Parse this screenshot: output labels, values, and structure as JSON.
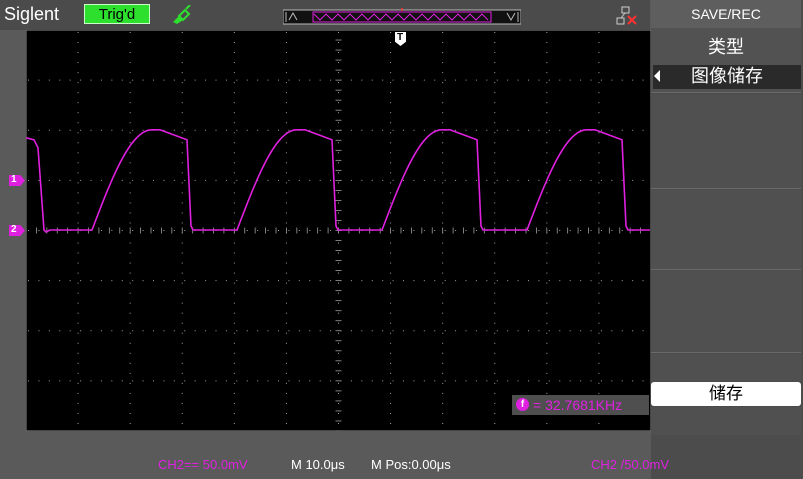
{
  "brand": "Siglent",
  "trigger_status": "Trig'd",
  "menu": {
    "title": "SAVE/REC",
    "type_label": "类型",
    "type_value": "图像储存",
    "save_label": "储存"
  },
  "measurement": {
    "icon": "f",
    "frequency": "= 32.7681KHz"
  },
  "status_bar": {
    "ch2_scale": "CH2== 50.0mV",
    "timebase": "M 10.0μs",
    "mpos": "M Pos:0.00μs",
    "trigger": "CH2 /50.0mV"
  },
  "markers": {
    "trigger_marker": "T",
    "ch_marker_1": "1",
    "ch_marker_2": "2"
  },
  "colors": {
    "trace": "#e020e0",
    "trig_ok": "#2ee02e",
    "grid": "#a0a0a0"
  },
  "waveform": {
    "period_us": 28.6,
    "high_level_div": 2.0,
    "low_level_div": 0.0
  }
}
